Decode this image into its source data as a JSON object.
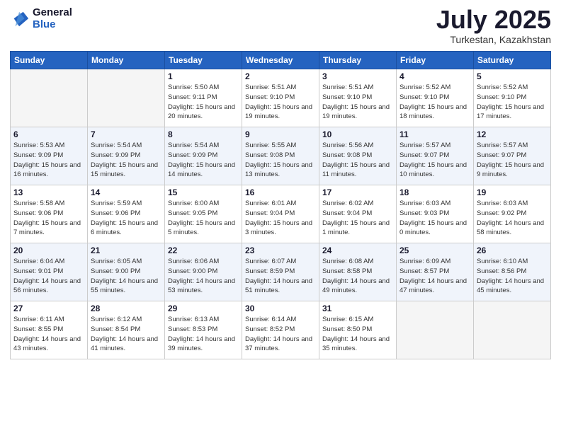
{
  "header": {
    "logo_general": "General",
    "logo_blue": "Blue",
    "month": "July 2025",
    "location": "Turkestan, Kazakhstan"
  },
  "days_of_week": [
    "Sunday",
    "Monday",
    "Tuesday",
    "Wednesday",
    "Thursday",
    "Friday",
    "Saturday"
  ],
  "weeks": [
    [
      {
        "day": "",
        "sunrise": "",
        "sunset": "",
        "daylight": ""
      },
      {
        "day": "",
        "sunrise": "",
        "sunset": "",
        "daylight": ""
      },
      {
        "day": "1",
        "sunrise": "Sunrise: 5:50 AM",
        "sunset": "Sunset: 9:11 PM",
        "daylight": "Daylight: 15 hours and 20 minutes."
      },
      {
        "day": "2",
        "sunrise": "Sunrise: 5:51 AM",
        "sunset": "Sunset: 9:10 PM",
        "daylight": "Daylight: 15 hours and 19 minutes."
      },
      {
        "day": "3",
        "sunrise": "Sunrise: 5:51 AM",
        "sunset": "Sunset: 9:10 PM",
        "daylight": "Daylight: 15 hours and 19 minutes."
      },
      {
        "day": "4",
        "sunrise": "Sunrise: 5:52 AM",
        "sunset": "Sunset: 9:10 PM",
        "daylight": "Daylight: 15 hours and 18 minutes."
      },
      {
        "day": "5",
        "sunrise": "Sunrise: 5:52 AM",
        "sunset": "Sunset: 9:10 PM",
        "daylight": "Daylight: 15 hours and 17 minutes."
      }
    ],
    [
      {
        "day": "6",
        "sunrise": "Sunrise: 5:53 AM",
        "sunset": "Sunset: 9:09 PM",
        "daylight": "Daylight: 15 hours and 16 minutes."
      },
      {
        "day": "7",
        "sunrise": "Sunrise: 5:54 AM",
        "sunset": "Sunset: 9:09 PM",
        "daylight": "Daylight: 15 hours and 15 minutes."
      },
      {
        "day": "8",
        "sunrise": "Sunrise: 5:54 AM",
        "sunset": "Sunset: 9:09 PM",
        "daylight": "Daylight: 15 hours and 14 minutes."
      },
      {
        "day": "9",
        "sunrise": "Sunrise: 5:55 AM",
        "sunset": "Sunset: 9:08 PM",
        "daylight": "Daylight: 15 hours and 13 minutes."
      },
      {
        "day": "10",
        "sunrise": "Sunrise: 5:56 AM",
        "sunset": "Sunset: 9:08 PM",
        "daylight": "Daylight: 15 hours and 11 minutes."
      },
      {
        "day": "11",
        "sunrise": "Sunrise: 5:57 AM",
        "sunset": "Sunset: 9:07 PM",
        "daylight": "Daylight: 15 hours and 10 minutes."
      },
      {
        "day": "12",
        "sunrise": "Sunrise: 5:57 AM",
        "sunset": "Sunset: 9:07 PM",
        "daylight": "Daylight: 15 hours and 9 minutes."
      }
    ],
    [
      {
        "day": "13",
        "sunrise": "Sunrise: 5:58 AM",
        "sunset": "Sunset: 9:06 PM",
        "daylight": "Daylight: 15 hours and 7 minutes."
      },
      {
        "day": "14",
        "sunrise": "Sunrise: 5:59 AM",
        "sunset": "Sunset: 9:06 PM",
        "daylight": "Daylight: 15 hours and 6 minutes."
      },
      {
        "day": "15",
        "sunrise": "Sunrise: 6:00 AM",
        "sunset": "Sunset: 9:05 PM",
        "daylight": "Daylight: 15 hours and 5 minutes."
      },
      {
        "day": "16",
        "sunrise": "Sunrise: 6:01 AM",
        "sunset": "Sunset: 9:04 PM",
        "daylight": "Daylight: 15 hours and 3 minutes."
      },
      {
        "day": "17",
        "sunrise": "Sunrise: 6:02 AM",
        "sunset": "Sunset: 9:04 PM",
        "daylight": "Daylight: 15 hours and 1 minute."
      },
      {
        "day": "18",
        "sunrise": "Sunrise: 6:03 AM",
        "sunset": "Sunset: 9:03 PM",
        "daylight": "Daylight: 15 hours and 0 minutes."
      },
      {
        "day": "19",
        "sunrise": "Sunrise: 6:03 AM",
        "sunset": "Sunset: 9:02 PM",
        "daylight": "Daylight: 14 hours and 58 minutes."
      }
    ],
    [
      {
        "day": "20",
        "sunrise": "Sunrise: 6:04 AM",
        "sunset": "Sunset: 9:01 PM",
        "daylight": "Daylight: 14 hours and 56 minutes."
      },
      {
        "day": "21",
        "sunrise": "Sunrise: 6:05 AM",
        "sunset": "Sunset: 9:00 PM",
        "daylight": "Daylight: 14 hours and 55 minutes."
      },
      {
        "day": "22",
        "sunrise": "Sunrise: 6:06 AM",
        "sunset": "Sunset: 9:00 PM",
        "daylight": "Daylight: 14 hours and 53 minutes."
      },
      {
        "day": "23",
        "sunrise": "Sunrise: 6:07 AM",
        "sunset": "Sunset: 8:59 PM",
        "daylight": "Daylight: 14 hours and 51 minutes."
      },
      {
        "day": "24",
        "sunrise": "Sunrise: 6:08 AM",
        "sunset": "Sunset: 8:58 PM",
        "daylight": "Daylight: 14 hours and 49 minutes."
      },
      {
        "day": "25",
        "sunrise": "Sunrise: 6:09 AM",
        "sunset": "Sunset: 8:57 PM",
        "daylight": "Daylight: 14 hours and 47 minutes."
      },
      {
        "day": "26",
        "sunrise": "Sunrise: 6:10 AM",
        "sunset": "Sunset: 8:56 PM",
        "daylight": "Daylight: 14 hours and 45 minutes."
      }
    ],
    [
      {
        "day": "27",
        "sunrise": "Sunrise: 6:11 AM",
        "sunset": "Sunset: 8:55 PM",
        "daylight": "Daylight: 14 hours and 43 minutes."
      },
      {
        "day": "28",
        "sunrise": "Sunrise: 6:12 AM",
        "sunset": "Sunset: 8:54 PM",
        "daylight": "Daylight: 14 hours and 41 minutes."
      },
      {
        "day": "29",
        "sunrise": "Sunrise: 6:13 AM",
        "sunset": "Sunset: 8:53 PM",
        "daylight": "Daylight: 14 hours and 39 minutes."
      },
      {
        "day": "30",
        "sunrise": "Sunrise: 6:14 AM",
        "sunset": "Sunset: 8:52 PM",
        "daylight": "Daylight: 14 hours and 37 minutes."
      },
      {
        "day": "31",
        "sunrise": "Sunrise: 6:15 AM",
        "sunset": "Sunset: 8:50 PM",
        "daylight": "Daylight: 14 hours and 35 minutes."
      },
      {
        "day": "",
        "sunrise": "",
        "sunset": "",
        "daylight": ""
      },
      {
        "day": "",
        "sunrise": "",
        "sunset": "",
        "daylight": ""
      }
    ]
  ]
}
